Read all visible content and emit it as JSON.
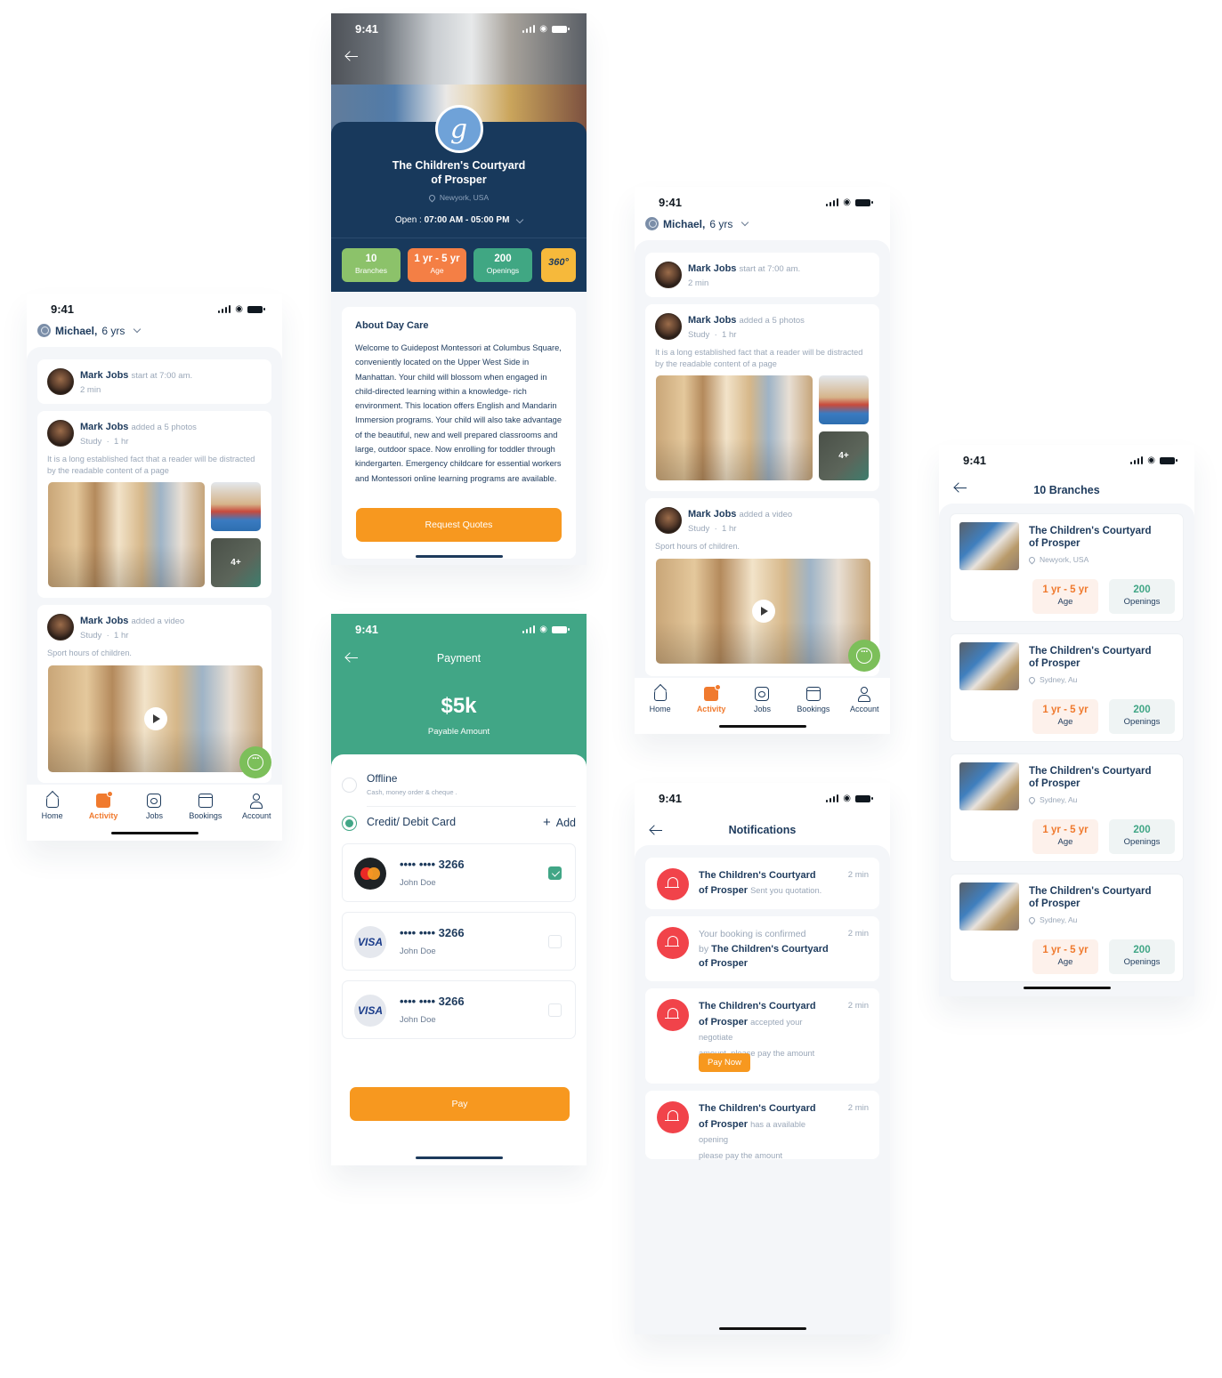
{
  "status_time": "9:41",
  "activity": {
    "child": {
      "name": "Michael,",
      "age": "6 yrs"
    },
    "posts": [
      {
        "author": "Mark Jobs",
        "action": "start at 7:00 am.",
        "meta": "2 min"
      },
      {
        "author": "Mark Jobs",
        "action": "added a 5 photos",
        "category": "Study",
        "time": "1 hr",
        "text": "It is a long established fact that a reader will be distracted by the readable content of a page",
        "more_photos": "4+"
      },
      {
        "author": "Mark Jobs",
        "action": "added a video",
        "category": "Study",
        "time": "1 hr",
        "text": "Sport hours of children."
      }
    ],
    "tabs": [
      {
        "label": "Home",
        "icon": "home-icon"
      },
      {
        "label": "Activity",
        "icon": "activity-icon",
        "active": true
      },
      {
        "label": "Jobs",
        "icon": "jobs-icon"
      },
      {
        "label": "Bookings",
        "icon": "calendar-icon"
      },
      {
        "label": "Account",
        "icon": "user-icon"
      }
    ]
  },
  "daycare": {
    "logo_letter": "g",
    "title_line1": "The Children's Courtyard",
    "title_line2": "of Prosper",
    "location": "Newyork, USA",
    "hours_label": "Open :",
    "hours": "07:00 AM - 05:00 PM",
    "stats": [
      {
        "value": "10",
        "label": "Branches",
        "color": "#8cc26a"
      },
      {
        "value": "1 yr - 5 yr",
        "label": "Age",
        "color": "#f47f45"
      },
      {
        "value": "200",
        "label": "Openings",
        "color": "#40a783"
      }
    ],
    "tour_label": "360°",
    "about_title": "About Day Care",
    "about_text": "Welcome to Guidepost Montessori at Columbus Square, conveniently located on the Upper West Side in Manhattan. Your child will blossom when engaged in child-directed learning within a knowledge- rich environment. This location offers English and Mandarin Immersion programs. Your child will also take advantage of the beautiful, new and well prepared classrooms and large, outdoor space. Now enrolling for toddler through kindergarten. Emergency childcare for essential workers and Montessori online learning programs are available.",
    "cta": "Request Quotes"
  },
  "payment": {
    "title": "Payment",
    "amount": "$5k",
    "amount_label": "Payable Amount",
    "offline": {
      "label": "Offline",
      "sub": "Cash, money order & cheque ."
    },
    "card_option": "Credit/ Debit Card",
    "add_label": "Add",
    "cards": [
      {
        "brand": "mastercard",
        "number": "•••• •••• 3266",
        "name": "John Doe",
        "selected": true
      },
      {
        "brand": "VISA",
        "number": "•••• •••• 3266",
        "name": "John Doe",
        "selected": false
      },
      {
        "brand": "VISA",
        "number": "•••• •••• 3266",
        "name": "John Doe",
        "selected": false
      }
    ],
    "pay_button": "Pay"
  },
  "notifications": {
    "title": "Notifications",
    "items": [
      {
        "bold1": "The Children's Courtyard",
        "bold2": "of Prosper",
        "text": "Sent you quotation.",
        "time": "2 min"
      },
      {
        "pre": "Your booking is confirmed",
        "by": "by",
        "bold1": "The Children's Courtyard",
        "bold2": "of Prosper",
        "time": "2 min"
      },
      {
        "bold1": "The Children's Courtyard",
        "bold2": "of Prosper",
        "text": "accepted your negotiate",
        "text2": "amount. please pay the amount",
        "time": "2 min",
        "button": "Pay Now"
      },
      {
        "bold1": "The Children's Courtyard",
        "bold2": "of Prosper",
        "text": "has a available opening",
        "text2": "please pay the amount",
        "time": "2 min"
      }
    ]
  },
  "branches": {
    "title": "10 Branches",
    "items": [
      {
        "name1": "The Children's Courtyard",
        "name2": "of Prosper",
        "location": "Newyork, USA",
        "age": "1 yr - 5 yr",
        "age_label": "Age",
        "openings": "200",
        "openings_label": "Openings"
      },
      {
        "name1": "The Children's Courtyard",
        "name2": "of Prosper",
        "location": "Sydney, Au",
        "age": "1 yr - 5 yr",
        "age_label": "Age",
        "openings": "200",
        "openings_label": "Openings"
      },
      {
        "name1": "The Children's Courtyard",
        "name2": "of Prosper",
        "location": "Sydney, Au",
        "age": "1 yr - 5 yr",
        "age_label": "Age",
        "openings": "200",
        "openings_label": "Openings"
      },
      {
        "name1": "The Children's Courtyard",
        "name2": "of Prosper",
        "location": "Sydney, Au",
        "age": "1 yr - 5 yr",
        "age_label": "Age",
        "openings": "200",
        "openings_label": "Openings"
      }
    ]
  }
}
